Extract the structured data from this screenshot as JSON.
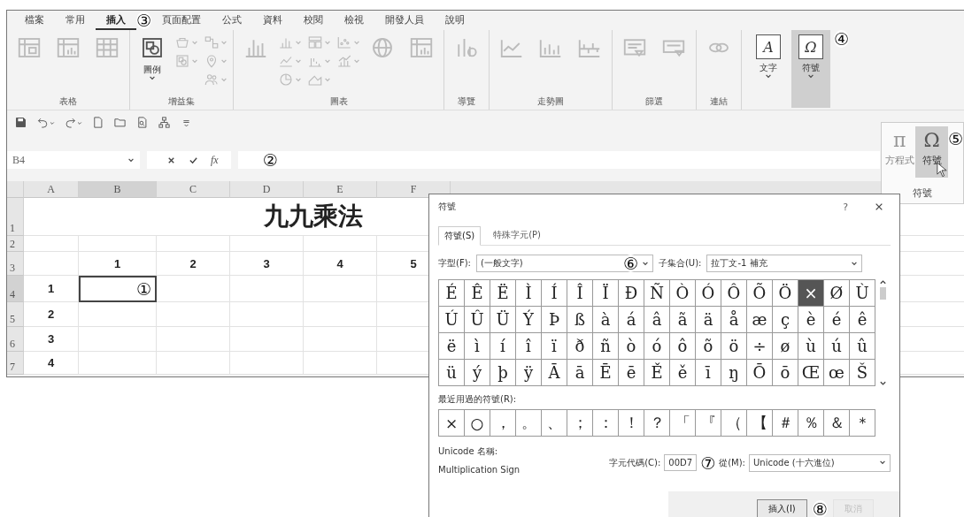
{
  "ribbon": {
    "tabs": [
      {
        "label": "檔案",
        "selected": false
      },
      {
        "label": "常用",
        "selected": false
      },
      {
        "label": "插入",
        "selected": true,
        "callout": "③"
      },
      {
        "label": "頁面配置",
        "selected": false
      },
      {
        "label": "公式",
        "selected": false
      },
      {
        "label": "資料",
        "selected": false
      },
      {
        "label": "校閱",
        "selected": false
      },
      {
        "label": "檢視",
        "selected": false
      },
      {
        "label": "開發人員",
        "selected": false
      },
      {
        "label": "說明",
        "selected": false
      }
    ],
    "groups": [
      {
        "label": "表格",
        "items": [
          {
            "kind": "large",
            "disabled": true
          },
          {
            "kind": "large",
            "disabled": true
          },
          {
            "kind": "large",
            "disabled": true
          }
        ]
      },
      {
        "label": "增益集",
        "items": [
          {
            "kind": "large",
            "label": "圖例",
            "disabled": false
          },
          {
            "kind": "stack",
            "buttons": [
              {
                "disabled": true
              },
              {
                "disabled": true
              }
            ]
          },
          {
            "kind": "stack",
            "buttons": [
              {
                "disabled": true
              },
              {
                "disabled": true
              },
              {
                "disabled": true
              }
            ]
          }
        ]
      },
      {
        "label": "圖表",
        "items": [
          {
            "kind": "large",
            "disabled": true
          },
          {
            "kind": "stack",
            "buttons": [
              {
                "disabled": true
              },
              {
                "disabled": true
              },
              {
                "disabled": true
              }
            ]
          },
          {
            "kind": "stack",
            "buttons": [
              {
                "disabled": true
              },
              {
                "disabled": true
              },
              {
                "disabled": true
              }
            ]
          },
          {
            "kind": "stack",
            "buttons": [
              {
                "disabled": true
              },
              {
                "disabled": true
              }
            ]
          },
          {
            "kind": "large",
            "disabled": true
          },
          {
            "kind": "large",
            "disabled": true
          }
        ]
      },
      {
        "label": "導覽",
        "items": [
          {
            "kind": "large",
            "disabled": true
          }
        ]
      },
      {
        "label": "走勢圖",
        "items": [
          {
            "kind": "large",
            "disabled": true
          },
          {
            "kind": "large",
            "disabled": true
          },
          {
            "kind": "large",
            "disabled": true
          }
        ]
      },
      {
        "label": "篩選",
        "items": [
          {
            "kind": "large",
            "disabled": true
          },
          {
            "kind": "large",
            "disabled": true
          }
        ]
      },
      {
        "label": "連結",
        "items": [
          {
            "kind": "large",
            "disabled": true
          }
        ]
      }
    ],
    "text_buttons": [
      {
        "glyph": "A",
        "label": "文字",
        "selected": false
      },
      {
        "glyph": "Ω",
        "label": "符號",
        "selected": true,
        "callout": "④"
      }
    ]
  },
  "quick_access": [
    {
      "caret": false
    },
    {
      "caret": true
    },
    {
      "caret": true
    },
    {
      "caret": false
    },
    {
      "caret": false
    },
    {
      "caret": false
    },
    {
      "caret": false
    },
    {
      "caret": false
    }
  ],
  "formula_bar": {
    "name_box": "B4",
    "fx": "fx",
    "callout": "②"
  },
  "sheet": {
    "columns": [
      "A",
      "B",
      "C",
      "D",
      "E",
      "F"
    ],
    "row_headers": [
      "1",
      "2",
      "3",
      "4",
      "5",
      "6",
      "7"
    ],
    "title": "九九乘法",
    "column_labels": [
      "1",
      "2",
      "3",
      "4",
      "5"
    ],
    "row_labels": [
      "1",
      "2",
      "3",
      "4"
    ],
    "active_cell_callout": "①"
  },
  "symbol_menu": {
    "buttons": [
      {
        "glyph": "π",
        "label": "方程式",
        "disabled": true,
        "selected": false
      },
      {
        "glyph": "Ω",
        "label": "符號",
        "disabled": false,
        "selected": true,
        "callout": "⑤"
      }
    ],
    "group_label": "符號"
  },
  "dialog": {
    "title": "符號",
    "help": "?",
    "tabs": [
      {
        "label": "符號(S)",
        "selected": true
      },
      {
        "label": "特殊字元(P)",
        "selected": false
      }
    ],
    "font_label": "字型(F):",
    "font_value": "(一般文字)",
    "font_callout": "⑥",
    "subset_label": "子集合(U):",
    "subset_value": "拉丁文-1 補充",
    "grid": [
      [
        {
          "char": "É",
          "selected": false
        },
        {
          "char": "Ê",
          "selected": false
        },
        {
          "char": "Ë",
          "selected": false
        },
        {
          "char": "Ì",
          "selected": false
        },
        {
          "char": "Í",
          "selected": false
        },
        {
          "char": "Î",
          "selected": false
        },
        {
          "char": "Ï",
          "selected": false
        },
        {
          "char": "Ð",
          "selected": false
        },
        {
          "char": "Ñ",
          "selected": false
        },
        {
          "char": "Ò",
          "selected": false
        },
        {
          "char": "Ó",
          "selected": false
        },
        {
          "char": "Ô",
          "selected": false
        },
        {
          "char": "Õ",
          "selected": false
        },
        {
          "char": "Ö",
          "selected": false
        },
        {
          "char": "×",
          "selected": true
        },
        {
          "char": "Ø",
          "selected": false
        },
        {
          "char": "Ù",
          "selected": false
        }
      ],
      [
        {
          "char": "Ú",
          "selected": false
        },
        {
          "char": "Û",
          "selected": false
        },
        {
          "char": "Ü",
          "selected": false
        },
        {
          "char": "Ý",
          "selected": false
        },
        {
          "char": "Þ",
          "selected": false
        },
        {
          "char": "ß",
          "selected": false
        },
        {
          "char": "à",
          "selected": false
        },
        {
          "char": "á",
          "selected": false
        },
        {
          "char": "â",
          "selected": false
        },
        {
          "char": "ã",
          "selected": false
        },
        {
          "char": "ä",
          "selected": false
        },
        {
          "char": "å",
          "selected": false
        },
        {
          "char": "æ",
          "selected": false
        },
        {
          "char": "ç",
          "selected": false
        },
        {
          "char": "è",
          "selected": false
        },
        {
          "char": "é",
          "selected": false
        },
        {
          "char": "ê",
          "selected": false
        }
      ],
      [
        {
          "char": "ë",
          "selected": false
        },
        {
          "char": "ì",
          "selected": false
        },
        {
          "char": "í",
          "selected": false
        },
        {
          "char": "î",
          "selected": false
        },
        {
          "char": "ï",
          "selected": false
        },
        {
          "char": "ð",
          "selected": false
        },
        {
          "char": "ñ",
          "selected": false
        },
        {
          "char": "ò",
          "selected": false
        },
        {
          "char": "ó",
          "selected": false
        },
        {
          "char": "ô",
          "selected": false
        },
        {
          "char": "õ",
          "selected": false
        },
        {
          "char": "ö",
          "selected": false
        },
        {
          "char": "÷",
          "selected": false
        },
        {
          "char": "ø",
          "selected": false
        },
        {
          "char": "ù",
          "selected": false
        },
        {
          "char": "ú",
          "selected": false
        },
        {
          "char": "û",
          "selected": false
        }
      ],
      [
        {
          "char": "ü",
          "selected": false
        },
        {
          "char": "ý",
          "selected": false
        },
        {
          "char": "þ",
          "selected": false
        },
        {
          "char": "ÿ",
          "selected": false
        },
        {
          "char": "Ā",
          "selected": false
        },
        {
          "char": "ā",
          "selected": false
        },
        {
          "char": "Ē",
          "selected": false
        },
        {
          "char": "ē",
          "selected": false
        },
        {
          "char": "Ě",
          "selected": false
        },
        {
          "char": "ě",
          "selected": false
        },
        {
          "char": "ī",
          "selected": false
        },
        {
          "char": "ŋ",
          "selected": false
        },
        {
          "char": "Ō",
          "selected": false
        },
        {
          "char": "ō",
          "selected": false
        },
        {
          "char": "Œ",
          "selected": false
        },
        {
          "char": "œ",
          "selected": false
        },
        {
          "char": "Š",
          "selected": false
        }
      ]
    ],
    "recent_label": "最近用過的符號(R):",
    "recent": [
      "×",
      "○",
      "，",
      "。",
      "、",
      "；",
      "：",
      "！",
      "？",
      "「",
      "『",
      "（",
      "【",
      "＃",
      "％",
      "＆",
      "＊"
    ],
    "unicode_name_label": "Unicode 名稱:",
    "unicode_name": "Multiplication Sign",
    "code_label": "字元代碼(C):",
    "code": "00D7",
    "code_callout": "⑦",
    "from_label": "從(M):",
    "from_value": "Unicode (十六進位)",
    "buttons": [
      {
        "label": "插入(I)",
        "callout": "⑧",
        "disabled": false
      },
      {
        "label": "取消",
        "disabled": true
      }
    ]
  }
}
